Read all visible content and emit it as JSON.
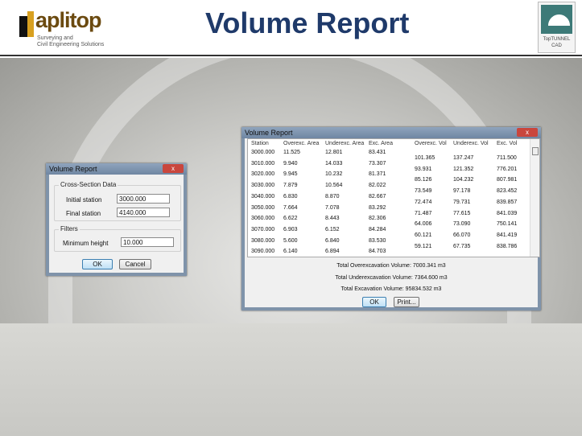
{
  "header": {
    "title": "Volume Report",
    "logo_name": "aplitop",
    "logo_tagline_1": "Surveying and",
    "logo_tagline_2": "Civil Engineering Solutions",
    "product_badge_1": "TopTUNNEL",
    "product_badge_2": "CAD"
  },
  "params_dialog": {
    "title": "Volume Report",
    "close": "x",
    "group_cross": "Cross-Section Data",
    "initial_label": "Initial station",
    "initial_value": "3000.000",
    "final_label": "Final station",
    "final_value": "4140.000",
    "group_filters": "Filters",
    "min_height_label": "Minimum height",
    "min_height_value": "10.000",
    "ok": "OK",
    "cancel": "Cancel"
  },
  "report_dialog": {
    "title": "Volume Report",
    "close": "x",
    "columns": [
      "Station",
      "Overexc. Area",
      "Underexc. Area",
      "Exc. Area",
      "Overexc. Vol",
      "Underexc. Vol",
      "Exc. Vol"
    ],
    "area_rows": [
      [
        "3000.000",
        "11.525",
        "12.801",
        "83.431"
      ],
      [
        "3010.000",
        "9.940",
        "14.033",
        "73.307"
      ],
      [
        "3020.000",
        "9.945",
        "10.232",
        "81.371"
      ],
      [
        "3030.000",
        "7.879",
        "10.564",
        "82.022"
      ],
      [
        "3040.000",
        "6.830",
        "8.870",
        "82.667"
      ],
      [
        "3050.000",
        "7.664",
        "7.078",
        "83.292"
      ],
      [
        "3060.000",
        "6.622",
        "8.443",
        "82.306"
      ],
      [
        "3070.000",
        "6.903",
        "6.152",
        "84.284"
      ],
      [
        "3080.000",
        "5.600",
        "6.840",
        "83.530"
      ],
      [
        "3090.000",
        "6.140",
        "6.894",
        "84.703"
      ]
    ],
    "volume_rows": [
      [
        "101.365",
        "137.247",
        "711.500"
      ],
      [
        "93.931",
        "121.352",
        "776.201"
      ],
      [
        "85.126",
        "104.232",
        "807.981"
      ],
      [
        "73.549",
        "97.178",
        "823.452"
      ],
      [
        "72.474",
        "79.731",
        "839.857"
      ],
      [
        "71.487",
        "77.615",
        "841.039"
      ],
      [
        "64.006",
        "73.090",
        "750.141"
      ],
      [
        "60.121",
        "66.070",
        "841.419"
      ],
      [
        "59.121",
        "67.735",
        "838.786"
      ]
    ],
    "total_over": "Total Overexcavation Volume: 7000.341 m3",
    "total_under": "Total Underexcavation Volume: 7364.600 m3",
    "total_exc": "Total Excavation Volume: 95834.532 m3",
    "ok": "OK",
    "print": "Print..."
  }
}
